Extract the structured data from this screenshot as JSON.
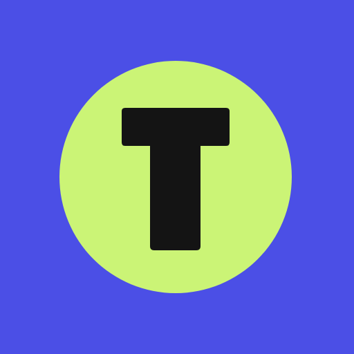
{
  "app_icon": {
    "name": "t-logo-icon",
    "letter_shape": "T",
    "colors": {
      "background": "#4b4fe6",
      "circle": "#cbf476",
      "letter": "#141414"
    }
  }
}
